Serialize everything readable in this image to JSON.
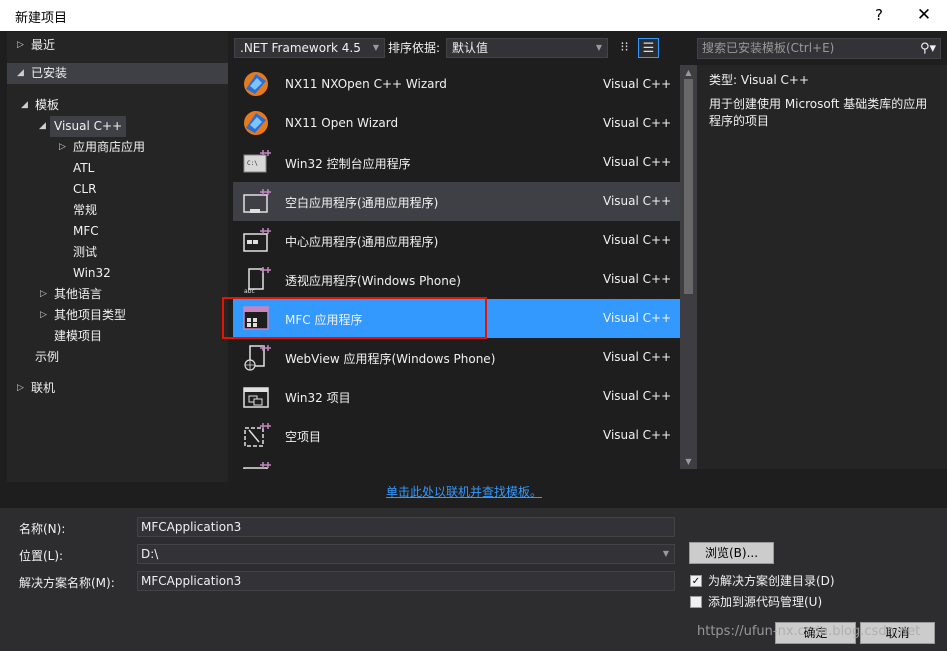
{
  "window": {
    "title": "新建项目",
    "help": "?",
    "close": "✕"
  },
  "sidebar": {
    "recent": "最近",
    "installed": "已安装",
    "templates": "模板",
    "visual_cpp": "Visual C++",
    "store_apps": "应用商店应用",
    "atl": "ATL",
    "clr": "CLR",
    "general": "常规",
    "mfc": "MFC",
    "test": "测试",
    "win32": "Win32",
    "other_languages": "其他语言",
    "other_project_types": "其他项目类型",
    "modeling_projects": "建模项目",
    "samples": "示例",
    "online": "联机"
  },
  "toolbar": {
    "framework": ".NET Framework 4.5",
    "sort_label": "排序依据:",
    "sort_value": "默认值"
  },
  "search": {
    "placeholder": "搜索已安装模板(Ctrl+E)"
  },
  "templates": [
    {
      "name": "NX11 NXOpen C++ Wizard",
      "lang": "Visual C++",
      "icon": "nx-icon"
    },
    {
      "name": "NX11 Open Wizard",
      "lang": "Visual C++",
      "icon": "nx-icon"
    },
    {
      "name": "Win32 控制台应用程序",
      "lang": "Visual C++",
      "icon": "console-icon"
    },
    {
      "name": "空白应用程序(通用应用程序)",
      "lang": "Visual C++",
      "icon": "blank-app-icon"
    },
    {
      "name": "中心应用程序(通用应用程序)",
      "lang": "Visual C++",
      "icon": "hub-app-icon"
    },
    {
      "name": "透视应用程序(Windows Phone)",
      "lang": "Visual C++",
      "icon": "pivot-app-icon"
    },
    {
      "name": "MFC 应用程序",
      "lang": "Visual C++",
      "icon": "mfc-app-icon"
    },
    {
      "name": "WebView 应用程序(Windows Phone)",
      "lang": "Visual C++",
      "icon": "webview-icon"
    },
    {
      "name": "Win32 项目",
      "lang": "Visual C++",
      "icon": "win32-project-icon"
    },
    {
      "name": "空项目",
      "lang": "Visual C++",
      "icon": "empty-project-icon"
    }
  ],
  "details": {
    "type_label": "类型:",
    "type_value": "Visual C++",
    "description": "用于创建使用 Microsoft 基础类库的应用程序的项目"
  },
  "online_link": "单击此处以联机并查找模板。",
  "form": {
    "name_label": "名称(N):",
    "name_value": "MFCApplication3",
    "location_label": "位置(L):",
    "location_value": "D:\\",
    "solution_label": "解决方案名称(M):",
    "solution_value": "MFCApplication3",
    "browse": "浏览(B)...",
    "create_dir": "为解决方案创建目录(D)",
    "create_dir_checked": true,
    "add_source_control": "添加到源代码管理(U)",
    "add_source_control_checked": false,
    "ok": "确定",
    "cancel": "取消"
  },
  "watermark": "https://ufun-nx.csdn.blog.csdn.net"
}
